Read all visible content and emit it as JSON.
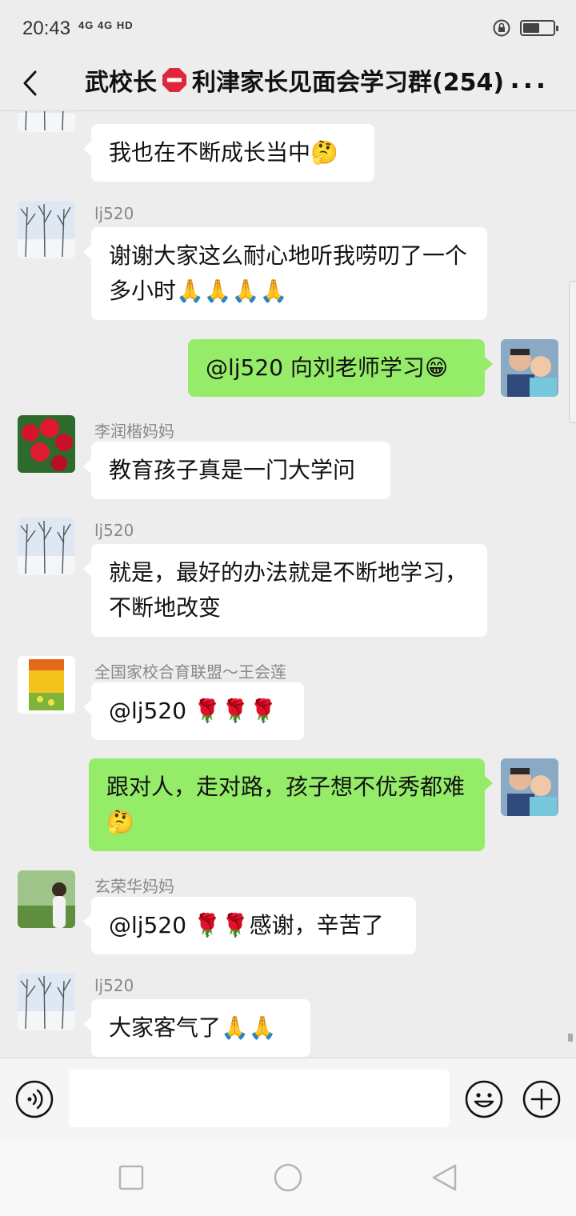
{
  "status_bar": {
    "time": "20:43",
    "network": "4G 4G HD",
    "battery_level": 0.55
  },
  "header": {
    "title_part1": "武校长",
    "title_part2": "利津家长见面会学习群(254)",
    "more": "···"
  },
  "messages": [
    {
      "side": "in",
      "sender": "lj520",
      "text": "我也在不断成长当中🤔"
    },
    {
      "side": "in",
      "sender": "lj520",
      "text": "谢谢大家这么耐心地听我唠叨了一个多小时🙏🙏🙏🙏"
    },
    {
      "side": "out",
      "sender": "",
      "text": "@lj520  向刘老师学习😁"
    },
    {
      "side": "in",
      "sender": "李润楷妈妈",
      "text": "教育孩子真是一门大学问"
    },
    {
      "side": "in",
      "sender": "lj520",
      "text": "就是，最好的办法就是不断地学习，不断地改变"
    },
    {
      "side": "in",
      "sender": "全国家校合育联盟～王会莲",
      "text": "@lj520 🌹🌹🌹"
    },
    {
      "side": "out",
      "sender": "",
      "text": "跟对人，走对路，孩子想不优秀都难🤔"
    },
    {
      "side": "in",
      "sender": "玄荣华妈妈",
      "text": "@lj520 🌹🌹感谢，辛苦了"
    },
    {
      "side": "in",
      "sender": "lj520",
      "text": "大家客气了🙏🙏"
    }
  ],
  "colors": {
    "background": "#ededed",
    "outgoing_bubble": "#95ec69",
    "incoming_bubble": "#ffffff"
  }
}
